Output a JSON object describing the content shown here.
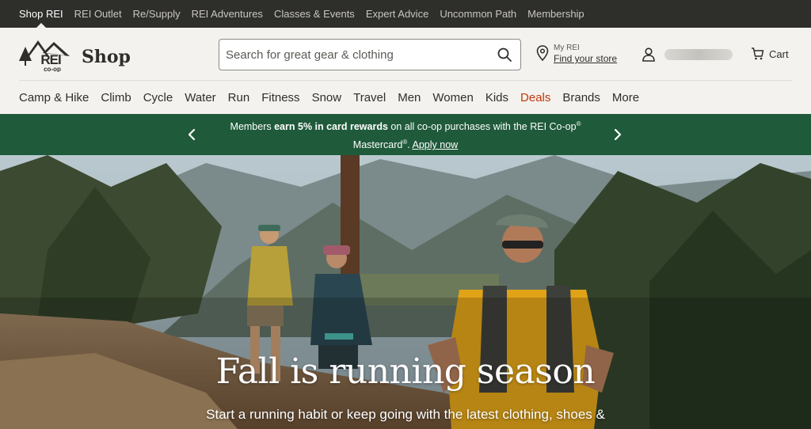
{
  "utility_nav": [
    "Shop REI",
    "REI Outlet",
    "Re/Supply",
    "REI Adventures",
    "Classes & Events",
    "Expert Advice",
    "Uncommon Path",
    "Membership"
  ],
  "header": {
    "logo_text": "REI co-op",
    "shop_label": "Shop",
    "search_placeholder": "Search for great gear & clothing",
    "store_small": "My REI",
    "store_link": "Find your store",
    "cart_label": "Cart"
  },
  "categories": [
    "Camp & Hike",
    "Climb",
    "Cycle",
    "Water",
    "Run",
    "Fitness",
    "Snow",
    "Travel",
    "Men",
    "Women",
    "Kids",
    "Deals",
    "Brands",
    "More"
  ],
  "promo": {
    "prefix": "Members ",
    "bold": "earn 5% in card rewards",
    "middle": " on all co-op purchases with the REI Co-op",
    "reg": "®",
    "line2": "Mastercard",
    "reg2": "®",
    "punct": ". ",
    "apply": "Apply now"
  },
  "hero": {
    "title": "Fall is running season",
    "subtitle": "Start a running habit or keep going with the latest clothing, shoes &"
  },
  "colors": {
    "utility_bg": "#2e2e2b",
    "promo_bg": "#1f5a3b",
    "deals": "#c0360f",
    "page_bg": "#f4f2ee"
  }
}
